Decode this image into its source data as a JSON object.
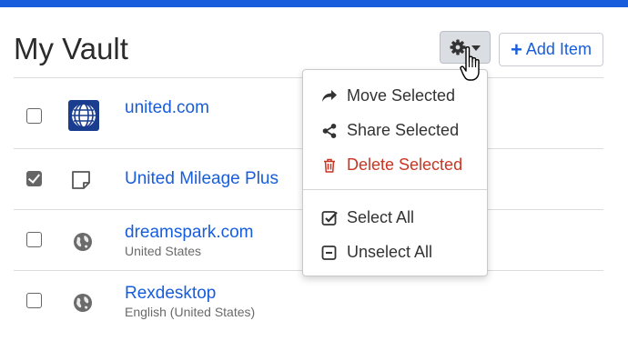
{
  "header": {
    "title": "My Vault",
    "add_item_label": "Add Item",
    "gear_icon": "gear-icon"
  },
  "colors": {
    "accent": "#175ddc",
    "danger": "#c83522",
    "text": "#333333"
  },
  "items": [
    {
      "name": "united.com",
      "subtitle": "",
      "checked": false,
      "icon": "united-logo-icon"
    },
    {
      "name": "United Mileage Plus",
      "subtitle": "",
      "checked": true,
      "icon": "sticky-note-icon"
    },
    {
      "name": "dreamspark.com",
      "subtitle": "United States",
      "checked": false,
      "icon": "globe-icon"
    },
    {
      "name": "Rexdesktop",
      "subtitle": "English (United States)",
      "checked": false,
      "icon": "globe-icon"
    }
  ],
  "menu": {
    "move": "Move Selected",
    "share": "Share Selected",
    "delete": "Delete Selected",
    "select_all": "Select All",
    "unselect_all": "Unselect All"
  }
}
